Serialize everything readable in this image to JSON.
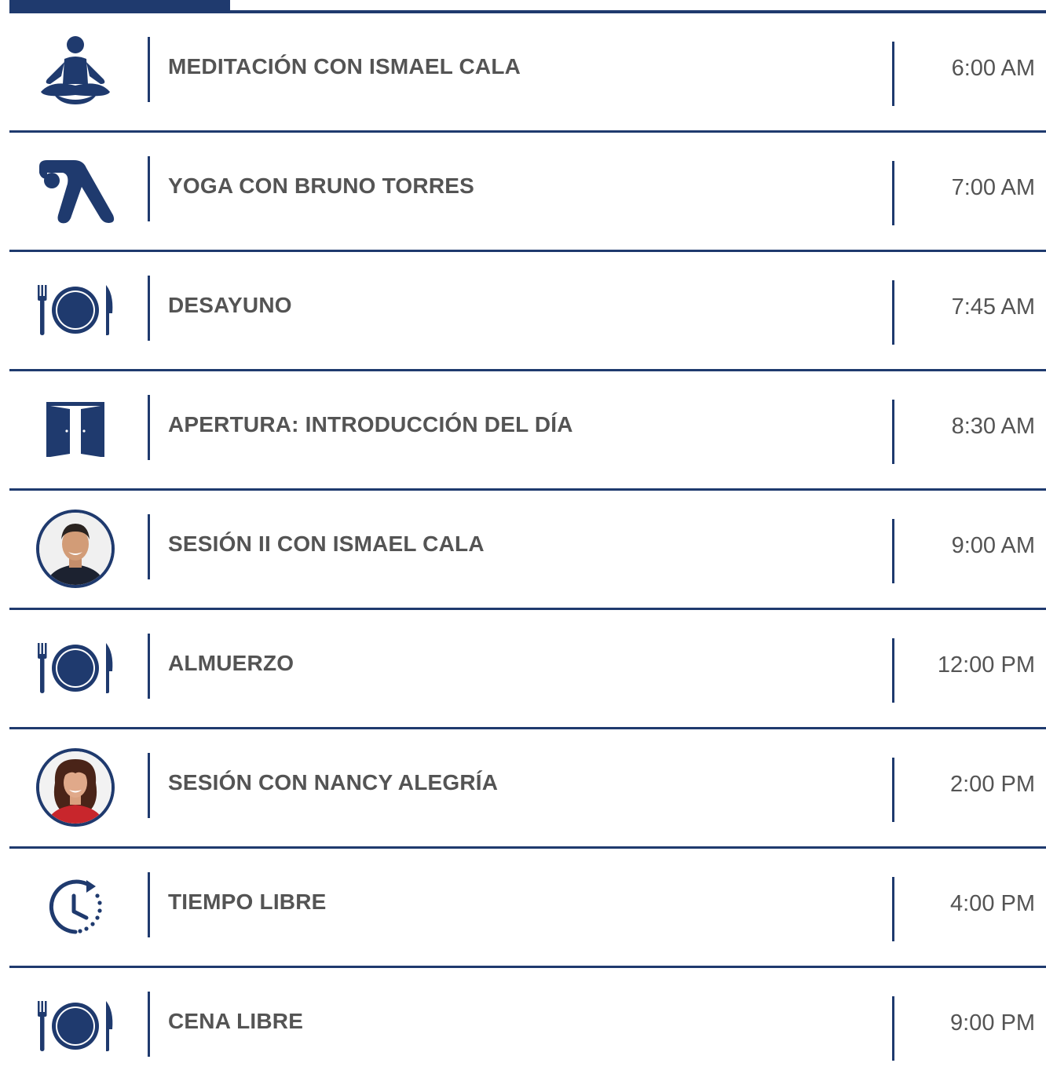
{
  "colors": {
    "accent": "#1f3a6e",
    "text": "#545454",
    "background": "#ffffff"
  },
  "schedule": [
    {
      "icon": "meditation-icon",
      "title": "MEDITACIÓN CON ISMAEL CALA",
      "time": "6:00 AM"
    },
    {
      "icon": "yoga-icon",
      "title": "YOGA CON BRUNO TORRES",
      "time": "7:00 AM"
    },
    {
      "icon": "meal-icon",
      "title": "DESAYUNO",
      "time": "7:45 AM"
    },
    {
      "icon": "door-icon",
      "title": "APERTURA: INTRODUCCIÓN DEL DÍA",
      "time": "8:30 AM"
    },
    {
      "icon": "speaker-avatar-male",
      "title": "SESIÓN II CON ISMAEL CALA",
      "time": "9:00 AM"
    },
    {
      "icon": "meal-icon",
      "title": "ALMUERZO",
      "time": "12:00 PM"
    },
    {
      "icon": "speaker-avatar-female",
      "title": "SESIÓN CON NANCY ALEGRÍA",
      "time": "2:00 PM"
    },
    {
      "icon": "clock-icon",
      "title": "TIEMPO LIBRE",
      "time": "4:00 PM"
    },
    {
      "icon": "meal-icon",
      "title": "CENA LIBRE",
      "time": "9:00 PM"
    }
  ]
}
